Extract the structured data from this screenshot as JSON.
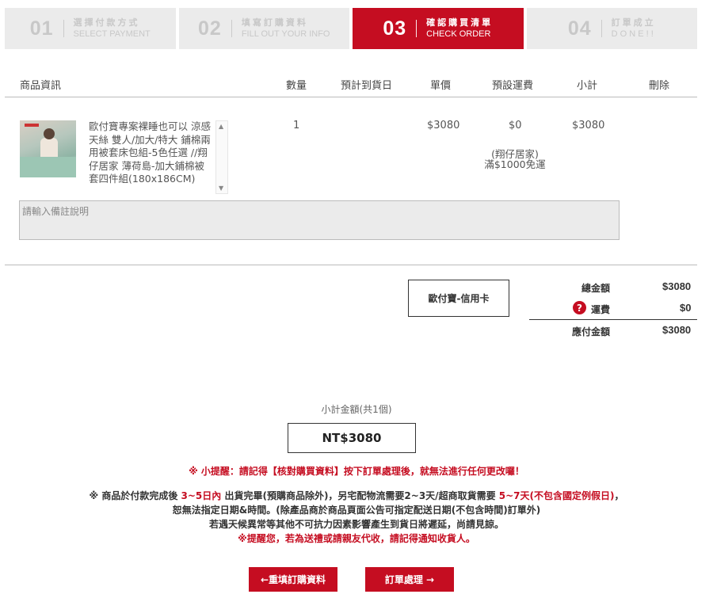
{
  "steps": [
    {
      "num": "01",
      "zh": "選擇付款方式",
      "en": "SELECT PAYMENT"
    },
    {
      "num": "02",
      "zh": "填寫訂購資料",
      "en": "FILL OUT YOUR INFO"
    },
    {
      "num": "03",
      "zh": "確認購買清單",
      "en": "CHECK ORDER"
    },
    {
      "num": "04",
      "zh": "訂單成立",
      "en": "D O N E ! !"
    }
  ],
  "table": {
    "headers": {
      "product": "商品資訊",
      "qty": "數量",
      "eta": "預計到貨日",
      "price": "單價",
      "shipping": "預設運費",
      "subtotal": "小計",
      "delete": "刪除"
    },
    "item": {
      "name": "歐付寶專案裸睡也可以 涼感天絲 雙人/加大/特大 鋪棉兩用被套床包組-5色任選 //翔仔居家 薄荷島-加大鋪棉被套四件組(180x186CM)",
      "qty": "1",
      "price": "$3080",
      "shipping": "$0",
      "shipping_note_1": "(翔仔居家)",
      "shipping_note_2": "滿$1000免運",
      "subtotal": "$3080"
    }
  },
  "remark": {
    "placeholder": "請輸入備註說明"
  },
  "payment_method": "歐付寶-信用卡",
  "summary": {
    "total_label": "總金額",
    "total_value": "$3080",
    "shipping_label": "運費",
    "shipping_value": "$0",
    "payable_label": "應付金額",
    "payable_value": "$3080"
  },
  "subtotal": {
    "label": "小計金額(共1個)",
    "value": "NT$3080"
  },
  "notices": {
    "warning": "※ 小提醒：請記得【核對購買資料】按下訂單處理後，就無法進行任何更改囉！",
    "line1_a": "※ 商品於付款完成後 ",
    "line1_b": "3~5日內",
    "line1_c": " 出貨完畢(預購商品除外)，另宅配物流需要2~3天/超商取貨需要 ",
    "line1_d": "5~7天(不包含國定例假日)",
    "line1_e": "，",
    "line2": "恕無法指定日期&時間。(除產品商於商品頁面公告可指定配送日期(不包含時間)訂單外)",
    "line3": "若遇天候異常等其他不可抗力因素影響產生到貨日將遲延，尚請見諒。",
    "line4": "※提醒您，若為送禮或請親友代收，請記得通知收貨人。"
  },
  "buttons": {
    "back": "←重填訂購資料",
    "next": "訂單處理 →"
  },
  "colors": {
    "accent": "#c50d21",
    "inactive_step": "#ebebeb"
  }
}
